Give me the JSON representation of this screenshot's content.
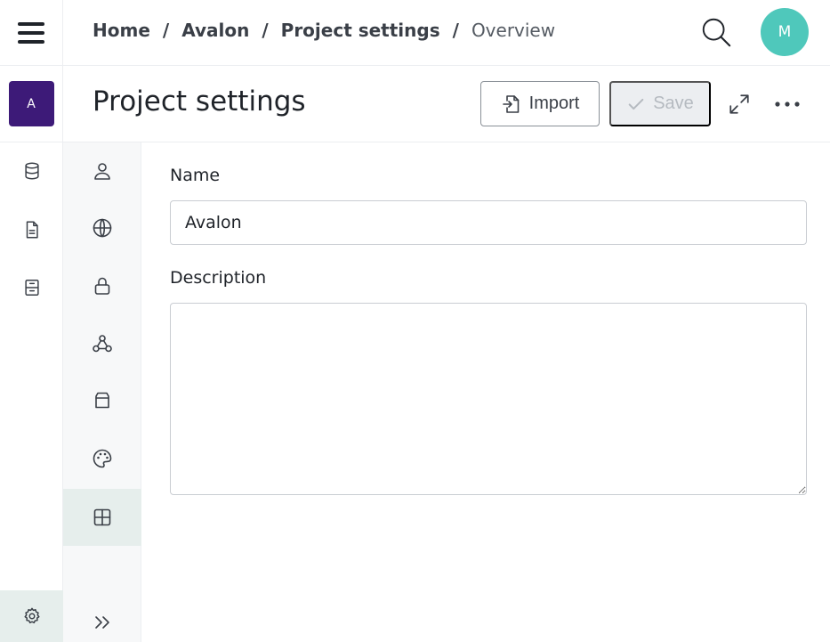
{
  "breadcrumb": {
    "items": [
      "Home",
      "Avalon",
      "Project settings"
    ],
    "current": "Overview",
    "separator": "/"
  },
  "user": {
    "initial": "M",
    "color": "#4fc8bb"
  },
  "project": {
    "initial": "A",
    "color": "#3d1a78"
  },
  "page": {
    "title": "Project settings",
    "import_label": "Import",
    "save_label": "Save"
  },
  "rail": {
    "items": [
      "database-icon",
      "document-icon",
      "archive-icon"
    ],
    "bottom": "settings-gear-icon"
  },
  "subnav": {
    "items": [
      "user-icon",
      "globe-icon",
      "lock-icon",
      "webhook-icon",
      "package-icon",
      "palette-icon",
      "grid-icon"
    ],
    "active": "grid-icon"
  },
  "form": {
    "name_label": "Name",
    "name_value": "Avalon",
    "description_label": "Description",
    "description_value": ""
  }
}
